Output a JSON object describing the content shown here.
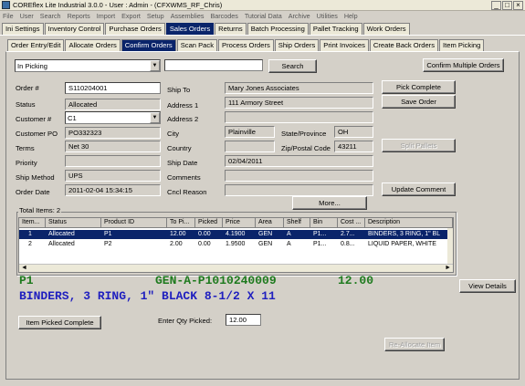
{
  "window": {
    "title": "COREflex Lite Industrial 3.0.0 - User : Admin - (CFXWMS_RF_Chris)"
  },
  "menu": [
    "File",
    "User",
    "Search",
    "Reports",
    "Import",
    "Export",
    "Setup",
    "Assemblies",
    "Barcodes",
    "Tutorial Data",
    "Archive",
    "Utilities",
    "Help"
  ],
  "module_tabs": [
    "Ini Settings",
    "Inventory Control",
    "Purchase Orders",
    "Sales Orders",
    "Returns",
    "Batch Processing",
    "Pallet Tracking",
    "Work Orders"
  ],
  "active_module": "Sales Orders",
  "sub_tabs": [
    "Order Entry/Edit",
    "Allocate Orders",
    "Confirm Orders",
    "Scan Pack",
    "Process Orders",
    "Ship Orders",
    "Print Invoices",
    "Create Back Orders",
    "Item Picking"
  ],
  "active_sub": "Confirm Orders",
  "filter": {
    "status": "In Picking",
    "search_value": "",
    "search_label": "Search",
    "confirm_multiple_label": "Confirm Multiple Orders"
  },
  "order": {
    "order_no_label": "Order #",
    "order_no": "S110204001",
    "status_label": "Status",
    "status": "Allocated",
    "customer_label": "Customer #",
    "customer": "C1",
    "customer_po_label": "Customer PO",
    "customer_po": "PO332323",
    "terms_label": "Terms",
    "terms": "Net 30",
    "priority_label": "Priority",
    "priority": "",
    "ship_method_label": "Ship Method",
    "ship_method": "UPS",
    "order_date_label": "Order Date",
    "order_date": "2011-02-04 15:34:15",
    "ship_to_label": "Ship To",
    "ship_to": "Mary Jones Associates",
    "address1_label": "Address 1",
    "address1": "111 Armory Street",
    "address2_label": "Address 2",
    "address2": "",
    "city_label": "City",
    "city": "Plainville",
    "state_label": "State/Province",
    "state": "OH",
    "country_label": "Country",
    "country": "",
    "zip_label": "Zip/Postal Code",
    "zip": "43211",
    "ship_date_label": "Ship Date",
    "ship_date": "02/04/2011",
    "comments_label": "Comments",
    "comments": "",
    "cncl_reason_label": "Cncl Reason",
    "cncl_reason": ""
  },
  "buttons": {
    "pick_complete": "Pick Complete",
    "save_order": "Save Order",
    "split_pallets": "Split Pallets",
    "update_comment": "Update Comment",
    "more": "More...",
    "view_details": "View Details",
    "item_picked_complete": "Item Picked Complete",
    "reallocate_item": "Re-Allocate Item"
  },
  "items": {
    "total_label": "Total Items: 2",
    "columns": [
      "Item...",
      "Status",
      "Product ID",
      "To Pi...",
      "Picked",
      "Price",
      "Area",
      "Shelf",
      "Bin",
      "Cost ...",
      "Description"
    ],
    "rows": [
      {
        "item": "1",
        "status": "Allocated",
        "product": "P1",
        "to_pick": "12.00",
        "picked": "0.00",
        "price": "4.1900",
        "area": "GEN",
        "shelf": "A",
        "bin": "P1...",
        "cost": "2.7...",
        "desc": "BINDERS, 3 RING, 1\" BL"
      },
      {
        "item": "2",
        "status": "Allocated",
        "product": "P2",
        "to_pick": "2.00",
        "picked": "0.00",
        "price": "1.9500",
        "area": "GEN",
        "shelf": "A",
        "bin": "P1...",
        "cost": "0.8...",
        "desc": "LIQUID PAPER, WHITE"
      }
    ]
  },
  "current_pick": {
    "product": "P1",
    "location": "GEN-A-P1010240009",
    "qty": "12.00",
    "description": "BINDERS, 3 RING, 1\" BLACK 8-1/2 X 11",
    "qty_label": "Enter Qty Picked:",
    "qty_value": "12.00"
  },
  "colors": {
    "active_tab": "#0a246a",
    "pick_green": "#1e7a1e",
    "pick_blue": "#1f1fbf"
  }
}
